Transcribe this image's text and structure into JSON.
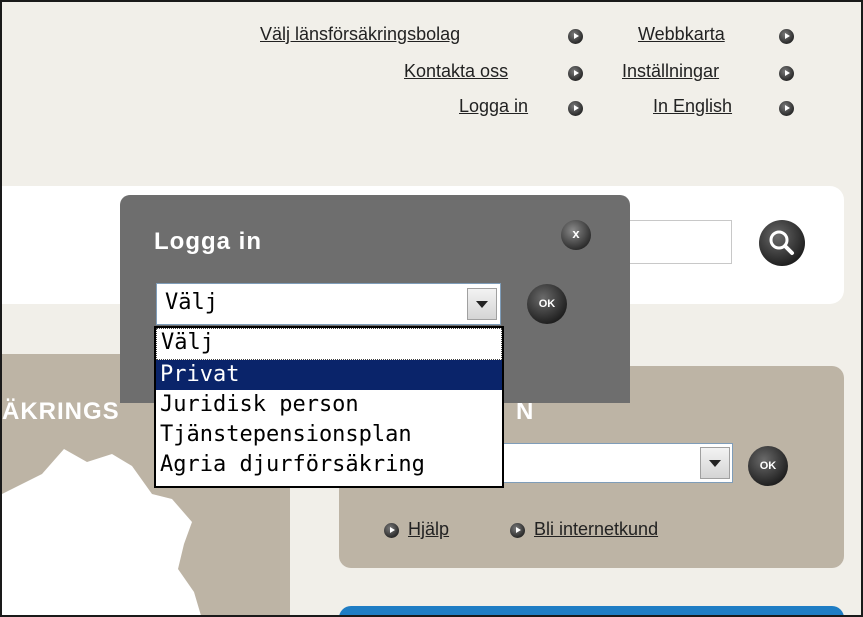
{
  "top_links": {
    "choose_company": "Välj länsförsäkringsbolag",
    "sitemap": "Webbkarta",
    "contact": "Kontakta oss",
    "settings": "Inställningar",
    "login": "Logga in",
    "english": "In English"
  },
  "background": {
    "left_partial_heading": "ÄKRINGS",
    "right_partial_heading": "N",
    "ok_label": "OK",
    "help_link": "Hjälp",
    "become_customer_link": "Bli internetkund"
  },
  "login_popup": {
    "title": "Logga in",
    "close_label": "x",
    "selected_value": "Välj",
    "ok_label": "OK",
    "options": [
      "Välj",
      "Privat",
      "Juridisk person",
      "Tjänstepensionsplan",
      "Agria djurförsäkring"
    ],
    "highlighted_option": "Privat"
  },
  "colors": {
    "page_background": "#f1efe9",
    "panel_background": "#6e6e6e",
    "highlight": "#0a246a",
    "beige_block": "#bdb4a5",
    "accent_blue": "#1f7dc4"
  }
}
